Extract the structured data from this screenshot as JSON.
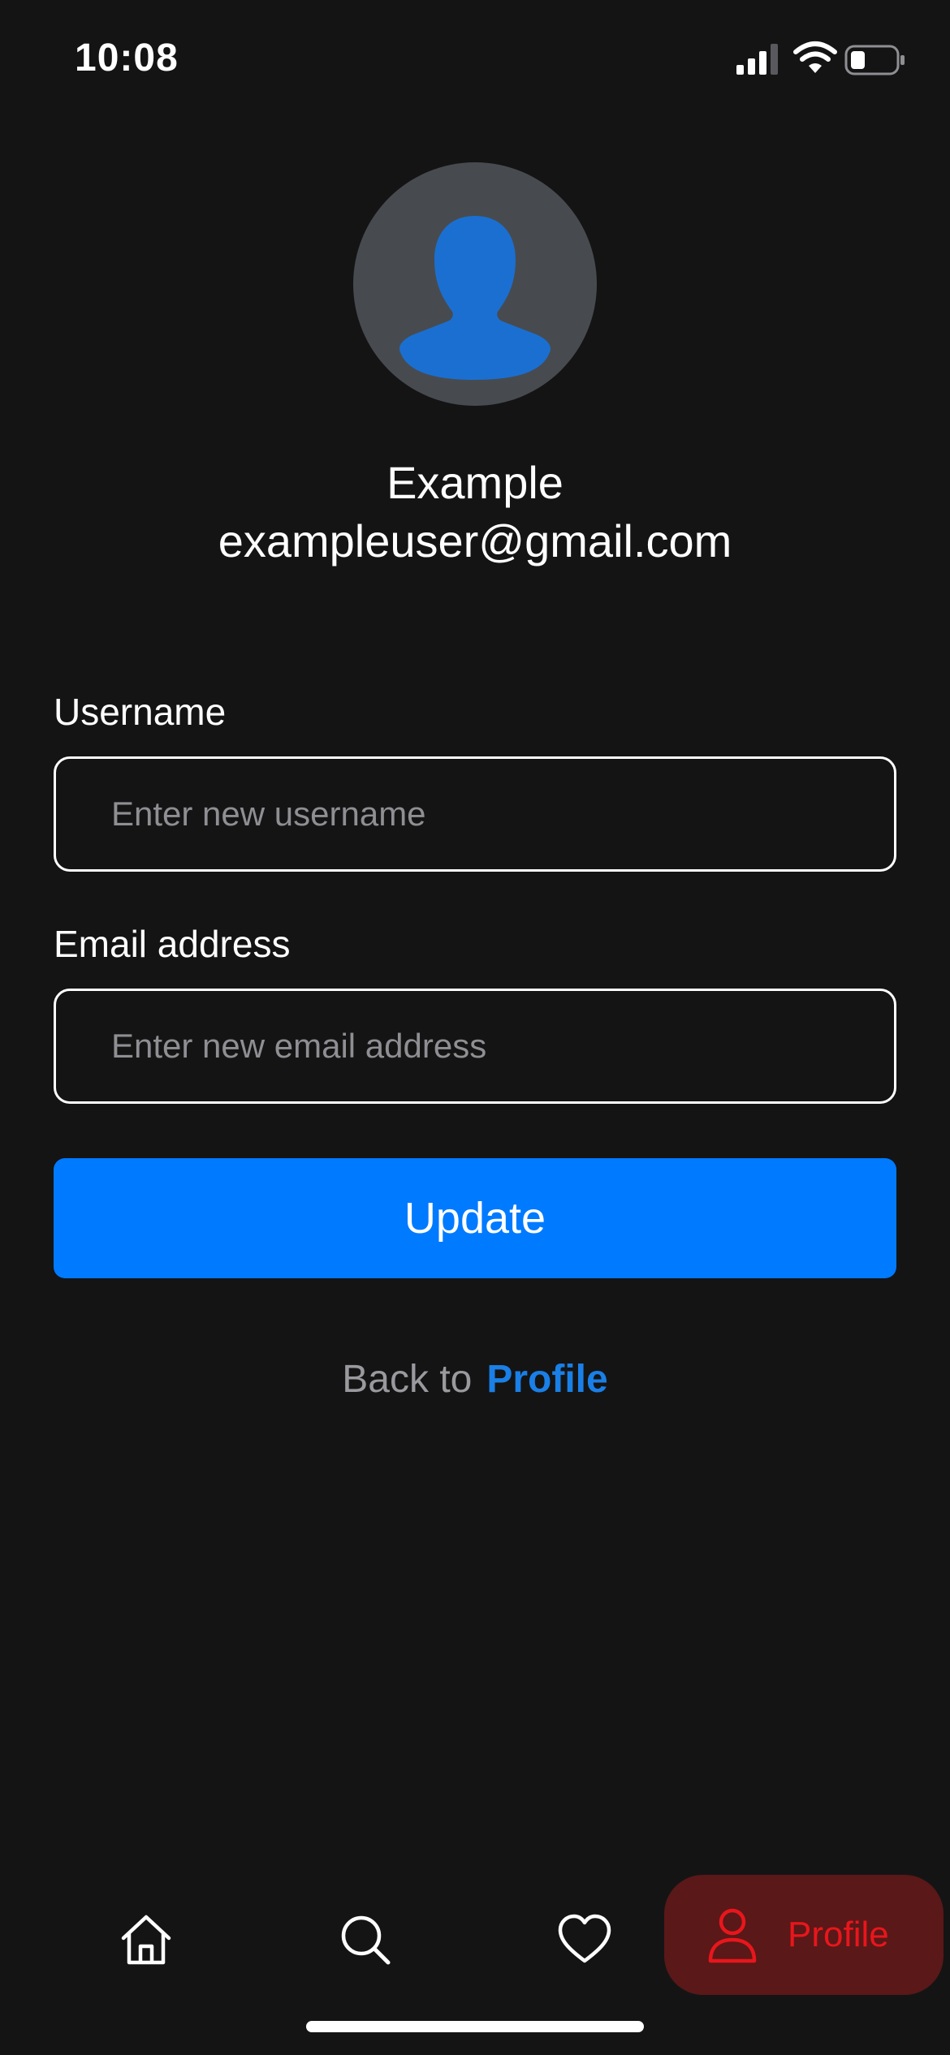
{
  "status_bar": {
    "time": "10:08",
    "icons": [
      "cellular-signal-icon",
      "wifi-icon",
      "battery-icon"
    ]
  },
  "profile": {
    "avatar_icon": "person-silhouette-icon",
    "name": "Example",
    "email": "exampleuser@gmail.com"
  },
  "form": {
    "username_label": "Username",
    "username_placeholder": "Enter new username",
    "username_value": "",
    "email_label": "Email address",
    "email_placeholder": "Enter new email address",
    "email_value": "",
    "update_label": "Update"
  },
  "back": {
    "text": "Back to",
    "link_label": "Profile"
  },
  "tab_bar": {
    "items": [
      {
        "icon": "home-icon",
        "label": "",
        "active": false
      },
      {
        "icon": "search-icon",
        "label": "",
        "active": false
      },
      {
        "icon": "heart-icon",
        "label": "",
        "active": false
      },
      {
        "icon": "person-icon",
        "label": "Profile",
        "active": true
      }
    ]
  },
  "colors": {
    "background": "#141415",
    "accent": "#007aff",
    "link": "#1a7fe6",
    "active_tab_bg": "#5a1818",
    "active_tab_fg": "#e8161c",
    "avatar_bg": "#474b4f",
    "avatar_fg": "#1b6fd1"
  }
}
